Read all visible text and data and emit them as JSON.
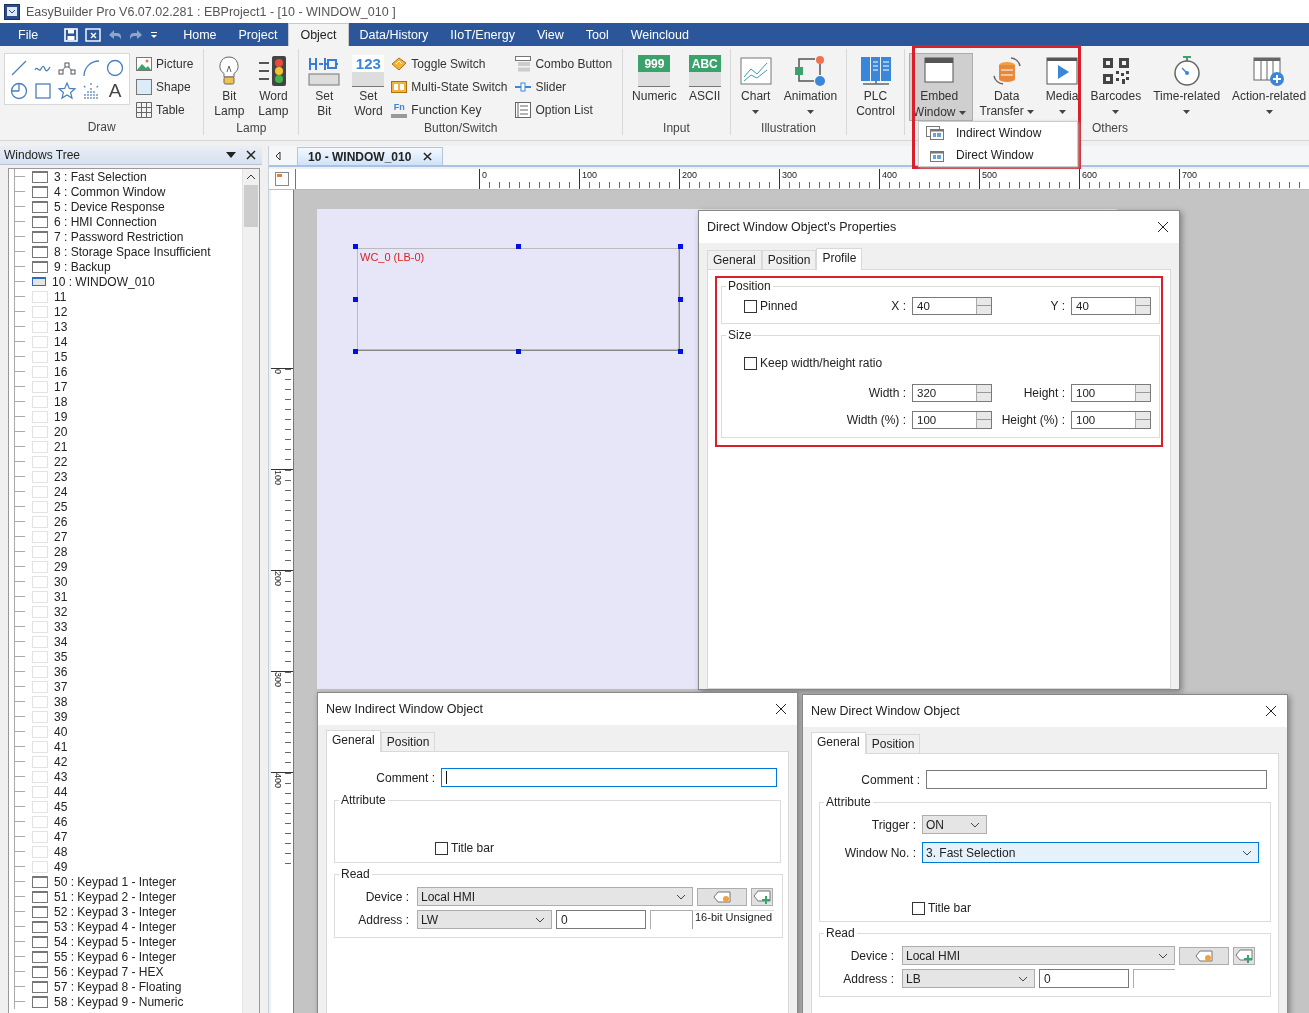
{
  "window": {
    "title": "EasyBuilder Pro V6.07.02.281 : EBProject1 - [10 - WINDOW_010 ]"
  },
  "file_menu": {
    "label": "File"
  },
  "menu_tabs": [
    {
      "label": "Home",
      "selected": false
    },
    {
      "label": "Project",
      "selected": false
    },
    {
      "label": "Object",
      "selected": true
    },
    {
      "label": "Data/History",
      "selected": false
    },
    {
      "label": "IIoT/Energy",
      "selected": false
    },
    {
      "label": "View",
      "selected": false
    },
    {
      "label": "Tool",
      "selected": false
    },
    {
      "label": "Weincloud",
      "selected": false
    }
  ],
  "ribbon": {
    "groups": [
      {
        "label": "Draw",
        "gallery_glyph": "A",
        "small": [
          {
            "label": "Picture"
          },
          {
            "label": "Shape"
          },
          {
            "label": "Table"
          }
        ]
      },
      {
        "label": "Lamp",
        "large": [
          {
            "lines": [
              "Bit",
              "Lamp"
            ],
            "dropdown": false,
            "selected": false
          },
          {
            "lines": [
              "Word",
              "Lamp"
            ],
            "dropdown": false,
            "selected": false
          }
        ]
      },
      {
        "label": "Button/Switch",
        "large": [
          {
            "lines": [
              "Set",
              "Bit"
            ],
            "dropdown": false,
            "selected": false
          },
          {
            "lines": [
              "Set",
              "Word"
            ],
            "icon_text": "123",
            "dropdown": false,
            "selected": false
          }
        ],
        "small": [
          {
            "label": "Toggle Switch"
          },
          {
            "label": "Multi-State Switch"
          },
          {
            "label": "Function Key",
            "icon_text": "Fn"
          },
          {
            "label": "Combo Button"
          },
          {
            "label": "Slider"
          },
          {
            "label": "Option List"
          }
        ]
      },
      {
        "label": "Input",
        "large": [
          {
            "lines": [
              "Numeric"
            ],
            "icon_text": "999",
            "dropdown": false,
            "selected": false
          },
          {
            "lines": [
              "ASCII"
            ],
            "icon_text": "ABC",
            "dropdown": false,
            "selected": false
          }
        ]
      },
      {
        "label": "Illustration",
        "large": [
          {
            "lines": [
              "Chart"
            ],
            "dropdown": true,
            "selected": false
          },
          {
            "lines": [
              "Animation"
            ],
            "dropdown": true,
            "selected": false
          }
        ]
      },
      {
        "large": [
          {
            "lines": [
              "PLC",
              "Control"
            ],
            "dropdown": false,
            "selected": false
          }
        ]
      },
      {
        "label": "Others",
        "large": [
          {
            "lines": [
              "Embed",
              "Window"
            ],
            "dropdown": true,
            "selected": true
          },
          {
            "lines": [
              "Data",
              "Transfer"
            ],
            "dropdown": true,
            "selected": false
          },
          {
            "lines": [
              "Media"
            ],
            "dropdown": true,
            "selected": false
          },
          {
            "lines": [
              "Barcodes"
            ],
            "dropdown": true,
            "selected": false
          },
          {
            "lines": [
              "Time-related"
            ],
            "dropdown": true,
            "selected": false
          },
          {
            "lines": [
              "Action-related"
            ],
            "dropdown": true,
            "selected": false
          }
        ]
      }
    ]
  },
  "dropdown_menu": {
    "items": [
      {
        "label": "Indirect Window"
      },
      {
        "label": "Direct Window"
      }
    ]
  },
  "windows_tree": {
    "title": "Windows Tree",
    "items": [
      {
        "label": "3 : Fast Selection",
        "defined": true,
        "selected": false
      },
      {
        "label": "4 : Common Window",
        "defined": true,
        "selected": false
      },
      {
        "label": "5 : Device Response",
        "defined": true,
        "selected": false
      },
      {
        "label": "6 : HMI Connection",
        "defined": true,
        "selected": false
      },
      {
        "label": "7 : Password Restriction",
        "defined": true,
        "selected": false
      },
      {
        "label": "8 : Storage Space Insufficient",
        "defined": true,
        "selected": false
      },
      {
        "label": "9 : Backup",
        "defined": true,
        "selected": false
      },
      {
        "label": "10 : WINDOW_010",
        "defined": true,
        "selected": true
      },
      {
        "label": "11",
        "defined": false,
        "selected": false
      },
      {
        "label": "12",
        "defined": false,
        "selected": false
      },
      {
        "label": "13",
        "defined": false,
        "selected": false
      },
      {
        "label": "14",
        "defined": false,
        "selected": false
      },
      {
        "label": "15",
        "defined": false,
        "selected": false
      },
      {
        "label": "16",
        "defined": false,
        "selected": false
      },
      {
        "label": "17",
        "defined": false,
        "selected": false
      },
      {
        "label": "18",
        "defined": false,
        "selected": false
      },
      {
        "label": "19",
        "defined": false,
        "selected": false
      },
      {
        "label": "20",
        "defined": false,
        "selected": false
      },
      {
        "label": "21",
        "defined": false,
        "selected": false
      },
      {
        "label": "22",
        "defined": false,
        "selected": false
      },
      {
        "label": "23",
        "defined": false,
        "selected": false
      },
      {
        "label": "24",
        "defined": false,
        "selected": false
      },
      {
        "label": "25",
        "defined": false,
        "selected": false
      },
      {
        "label": "26",
        "defined": false,
        "selected": false
      },
      {
        "label": "27",
        "defined": false,
        "selected": false
      },
      {
        "label": "28",
        "defined": false,
        "selected": false
      },
      {
        "label": "29",
        "defined": false,
        "selected": false
      },
      {
        "label": "30",
        "defined": false,
        "selected": false
      },
      {
        "label": "31",
        "defined": false,
        "selected": false
      },
      {
        "label": "32",
        "defined": false,
        "selected": false
      },
      {
        "label": "33",
        "defined": false,
        "selected": false
      },
      {
        "label": "34",
        "defined": false,
        "selected": false
      },
      {
        "label": "35",
        "defined": false,
        "selected": false
      },
      {
        "label": "36",
        "defined": false,
        "selected": false
      },
      {
        "label": "37",
        "defined": false,
        "selected": false
      },
      {
        "label": "38",
        "defined": false,
        "selected": false
      },
      {
        "label": "39",
        "defined": false,
        "selected": false
      },
      {
        "label": "40",
        "defined": false,
        "selected": false
      },
      {
        "label": "41",
        "defined": false,
        "selected": false
      },
      {
        "label": "42",
        "defined": false,
        "selected": false
      },
      {
        "label": "43",
        "defined": false,
        "selected": false
      },
      {
        "label": "44",
        "defined": false,
        "selected": false
      },
      {
        "label": "45",
        "defined": false,
        "selected": false
      },
      {
        "label": "46",
        "defined": false,
        "selected": false
      },
      {
        "label": "47",
        "defined": false,
        "selected": false
      },
      {
        "label": "48",
        "defined": false,
        "selected": false
      },
      {
        "label": "49",
        "defined": false,
        "selected": false
      },
      {
        "label": "50 : Keypad 1 - Integer",
        "defined": true,
        "selected": false
      },
      {
        "label": "51 : Keypad 2 - Integer",
        "defined": true,
        "selected": false
      },
      {
        "label": "52 : Keypad 3 - Integer",
        "defined": true,
        "selected": false
      },
      {
        "label": "53 : Keypad 4 - Integer",
        "defined": true,
        "selected": false
      },
      {
        "label": "54 : Keypad 5 - Integer",
        "defined": true,
        "selected": false
      },
      {
        "label": "55 : Keypad 6 - Integer",
        "defined": true,
        "selected": false
      },
      {
        "label": "56 : Keypad 7 - HEX",
        "defined": true,
        "selected": false
      },
      {
        "label": "57 : Keypad 8 - Floating",
        "defined": true,
        "selected": false
      },
      {
        "label": "58 : Keypad 9 - Numeric",
        "defined": true,
        "selected": false
      }
    ]
  },
  "editor_tab": {
    "label": "10 - WINDOW_010",
    "selected": true
  },
  "ruler": {
    "horizontal": [
      "0",
      "100",
      "200",
      "300",
      "400",
      "500",
      "600",
      "700"
    ],
    "vertical": [
      "0",
      "100",
      "200",
      "300",
      "400"
    ]
  },
  "canvas": {
    "object": {
      "label": "WC_0 (LB-0)",
      "selected": true
    }
  },
  "properties_dialog": {
    "title": "Direct Window Object's Properties",
    "tabs": [
      {
        "label": "General",
        "selected": false
      },
      {
        "label": "Position",
        "selected": false
      },
      {
        "label": "Profile",
        "selected": true
      }
    ],
    "position_group": {
      "label": "Position",
      "pinned": {
        "label": "Pinned",
        "checked": false
      },
      "x": {
        "label": "X :",
        "value": "40"
      },
      "y": {
        "label": "Y :",
        "value": "40"
      }
    },
    "size_group": {
      "label": "Size",
      "keep_ratio": {
        "label": "Keep width/height ratio",
        "checked": false
      },
      "fields": [
        {
          "label": "Width :",
          "value": "320"
        },
        {
          "label": "Height :",
          "value": "100"
        },
        {
          "label": "Width (%) :",
          "value": "100"
        },
        {
          "label": "Height (%) :",
          "value": "100"
        }
      ]
    }
  },
  "indirect_dialog": {
    "title": "New Indirect Window Object",
    "tabs": [
      {
        "label": "General",
        "selected": true
      },
      {
        "label": "Position",
        "selected": false
      }
    ],
    "comment": {
      "label": "Comment :",
      "focused": true
    },
    "attribute": {
      "label": "Attribute",
      "title_bar": {
        "label": "Title bar",
        "checked": false
      }
    },
    "read": {
      "label": "Read",
      "device": {
        "label": "Device :",
        "value": "Local HMI"
      },
      "address": {
        "label": "Address :",
        "type": "LW",
        "index": "0"
      },
      "data_type": "16-bit Unsigned"
    }
  },
  "direct_dialog": {
    "title": "New Direct Window Object",
    "tabs": [
      {
        "label": "General",
        "selected": true
      },
      {
        "label": "Position",
        "selected": false
      }
    ],
    "comment": {
      "label": "Comment :",
      "focused": false
    },
    "attribute": {
      "label": "Attribute",
      "trigger": {
        "label": "Trigger :",
        "value": "ON"
      },
      "window_no": {
        "label": "Window No. :",
        "value": "3. Fast Selection",
        "focused": true
      },
      "title_bar": {
        "label": "Title bar",
        "checked": false
      }
    },
    "read": {
      "label": "Read",
      "device": {
        "label": "Device :",
        "value": "Local HMI"
      },
      "address": {
        "label": "Address :",
        "type": "LB",
        "index": "0"
      }
    }
  }
}
